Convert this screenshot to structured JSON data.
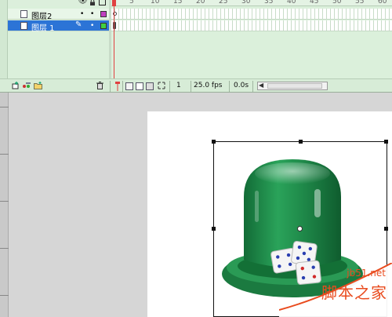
{
  "timeline": {
    "ruler_numbers": [
      "5",
      "10",
      "15",
      "20",
      "25",
      "30",
      "35",
      "40",
      "45",
      "50",
      "55",
      "60"
    ],
    "layers": [
      {
        "name": "图层2",
        "color": "#c040c0",
        "selected": false
      },
      {
        "name": "图层 1",
        "color": "#40d040",
        "selected": true
      }
    ],
    "toolbar": {
      "current_frame": "1",
      "frame_rate": "25.0 fps",
      "elapsed_time": "0.0s"
    }
  },
  "watermark": {
    "url": "jb51.net",
    "text": "脚本之家"
  },
  "colors": {
    "timeline_bg": "#dbf0db",
    "selected_layer": "#2c74d6",
    "playhead": "#e04040",
    "cup_green": "#1f8a4a",
    "watermark": "#e94b1e"
  },
  "icons": [
    "eye-icon",
    "lock-icon",
    "outline-icon",
    "layer-icon",
    "pencil-icon",
    "add-layer-icon",
    "add-guide-icon",
    "add-folder-icon",
    "trash-icon",
    "center-frame-icon",
    "onion-skin-icon",
    "onion-outline-icon",
    "edit-multiple-icon",
    "onion-markers-icon"
  ]
}
